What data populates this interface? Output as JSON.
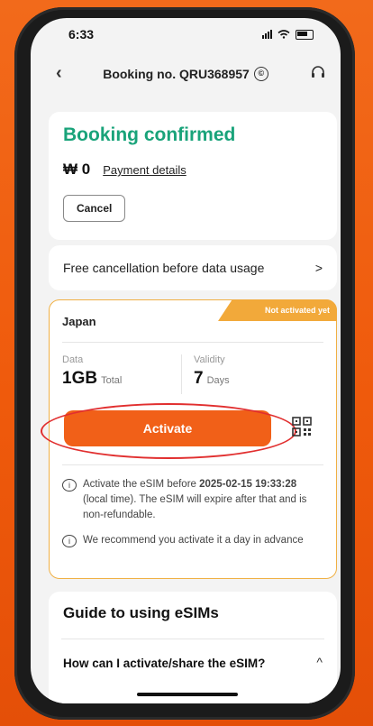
{
  "status": {
    "time": "6:33"
  },
  "header": {
    "title": "Booking no. QRU368957"
  },
  "booking": {
    "status": "Booking confirmed",
    "price": "₩ 0",
    "payment_link": "Payment details",
    "cancel_label": "Cancel"
  },
  "cancellation": {
    "text": "Free cancellation before data usage",
    "chevron": ">"
  },
  "esim": {
    "country": "Japan",
    "badge": "Not activated yet",
    "data_label": "Data",
    "data_value": "1GB",
    "data_unit": "Total",
    "validity_label": "Validity",
    "validity_value": "7",
    "validity_unit": "Days",
    "activate_label": "Activate",
    "note1_a": "Activate the eSIM before ",
    "note1_b": "2025-02-15 19:33:28",
    "note1_c": " (local time). The eSIM will expire after that and is non-refundable.",
    "note2": "We recommend you activate it a day in advance"
  },
  "guide": {
    "title": "Guide to using eSIMs",
    "faq1": "How can I activate/share the eSIM?"
  },
  "colors": {
    "accent": "#f16018",
    "success": "#19a37a",
    "badge": "#f2a93a",
    "highlight": "#e12f2f"
  }
}
